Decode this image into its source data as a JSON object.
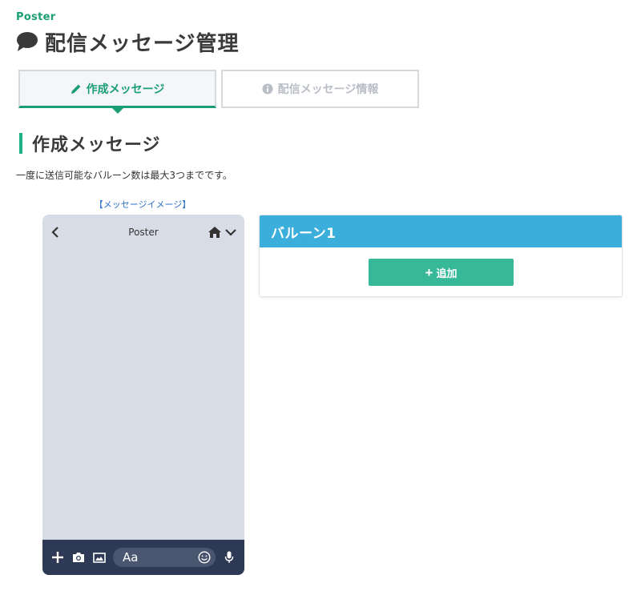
{
  "header": {
    "brand": "Poster",
    "page_title": "配信メッセージ管理"
  },
  "tabs": [
    {
      "label": "作成メッセージ",
      "icon": "pencil-icon",
      "active": true
    },
    {
      "label": "配信メッセージ情報",
      "icon": "info-circle-icon",
      "active": false
    }
  ],
  "section": {
    "heading": "作成メッセージ",
    "description": "一度に送信可能なバルーン数は最大3つまでです。"
  },
  "preview": {
    "label": "【メッセージイメージ】",
    "account_name": "Poster",
    "input_placeholder": "Aa"
  },
  "balloon": {
    "title": "バルーン1",
    "add_label": "追加"
  },
  "colors": {
    "accent_green": "#1a9e73",
    "balloon_header": "#3baedb",
    "add_button": "#37b898",
    "phone_bg": "#d8dce7",
    "phone_footer": "#2e3a55"
  }
}
